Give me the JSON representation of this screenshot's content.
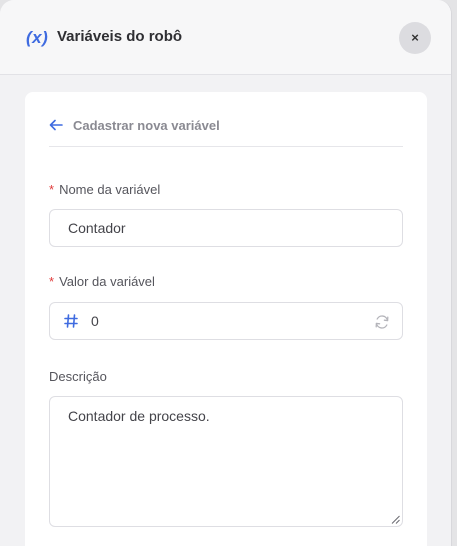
{
  "header": {
    "icon_text": "(x)",
    "title": "Variáveis do robô",
    "close_label": "×"
  },
  "form": {
    "back_title": "Cadastrar nova variável",
    "name_field": {
      "required_mark": "*",
      "label": "Nome da variável",
      "value": "Contador"
    },
    "value_field": {
      "required_mark": "*",
      "label": "Valor da variável",
      "type_icon": "hash-icon",
      "value": "0",
      "action_icon": "refresh-icon"
    },
    "description_field": {
      "label": "Descrição",
      "value": "Contador de processo."
    }
  },
  "colors": {
    "accent": "#3f6be0",
    "required": "#e03a3a"
  }
}
